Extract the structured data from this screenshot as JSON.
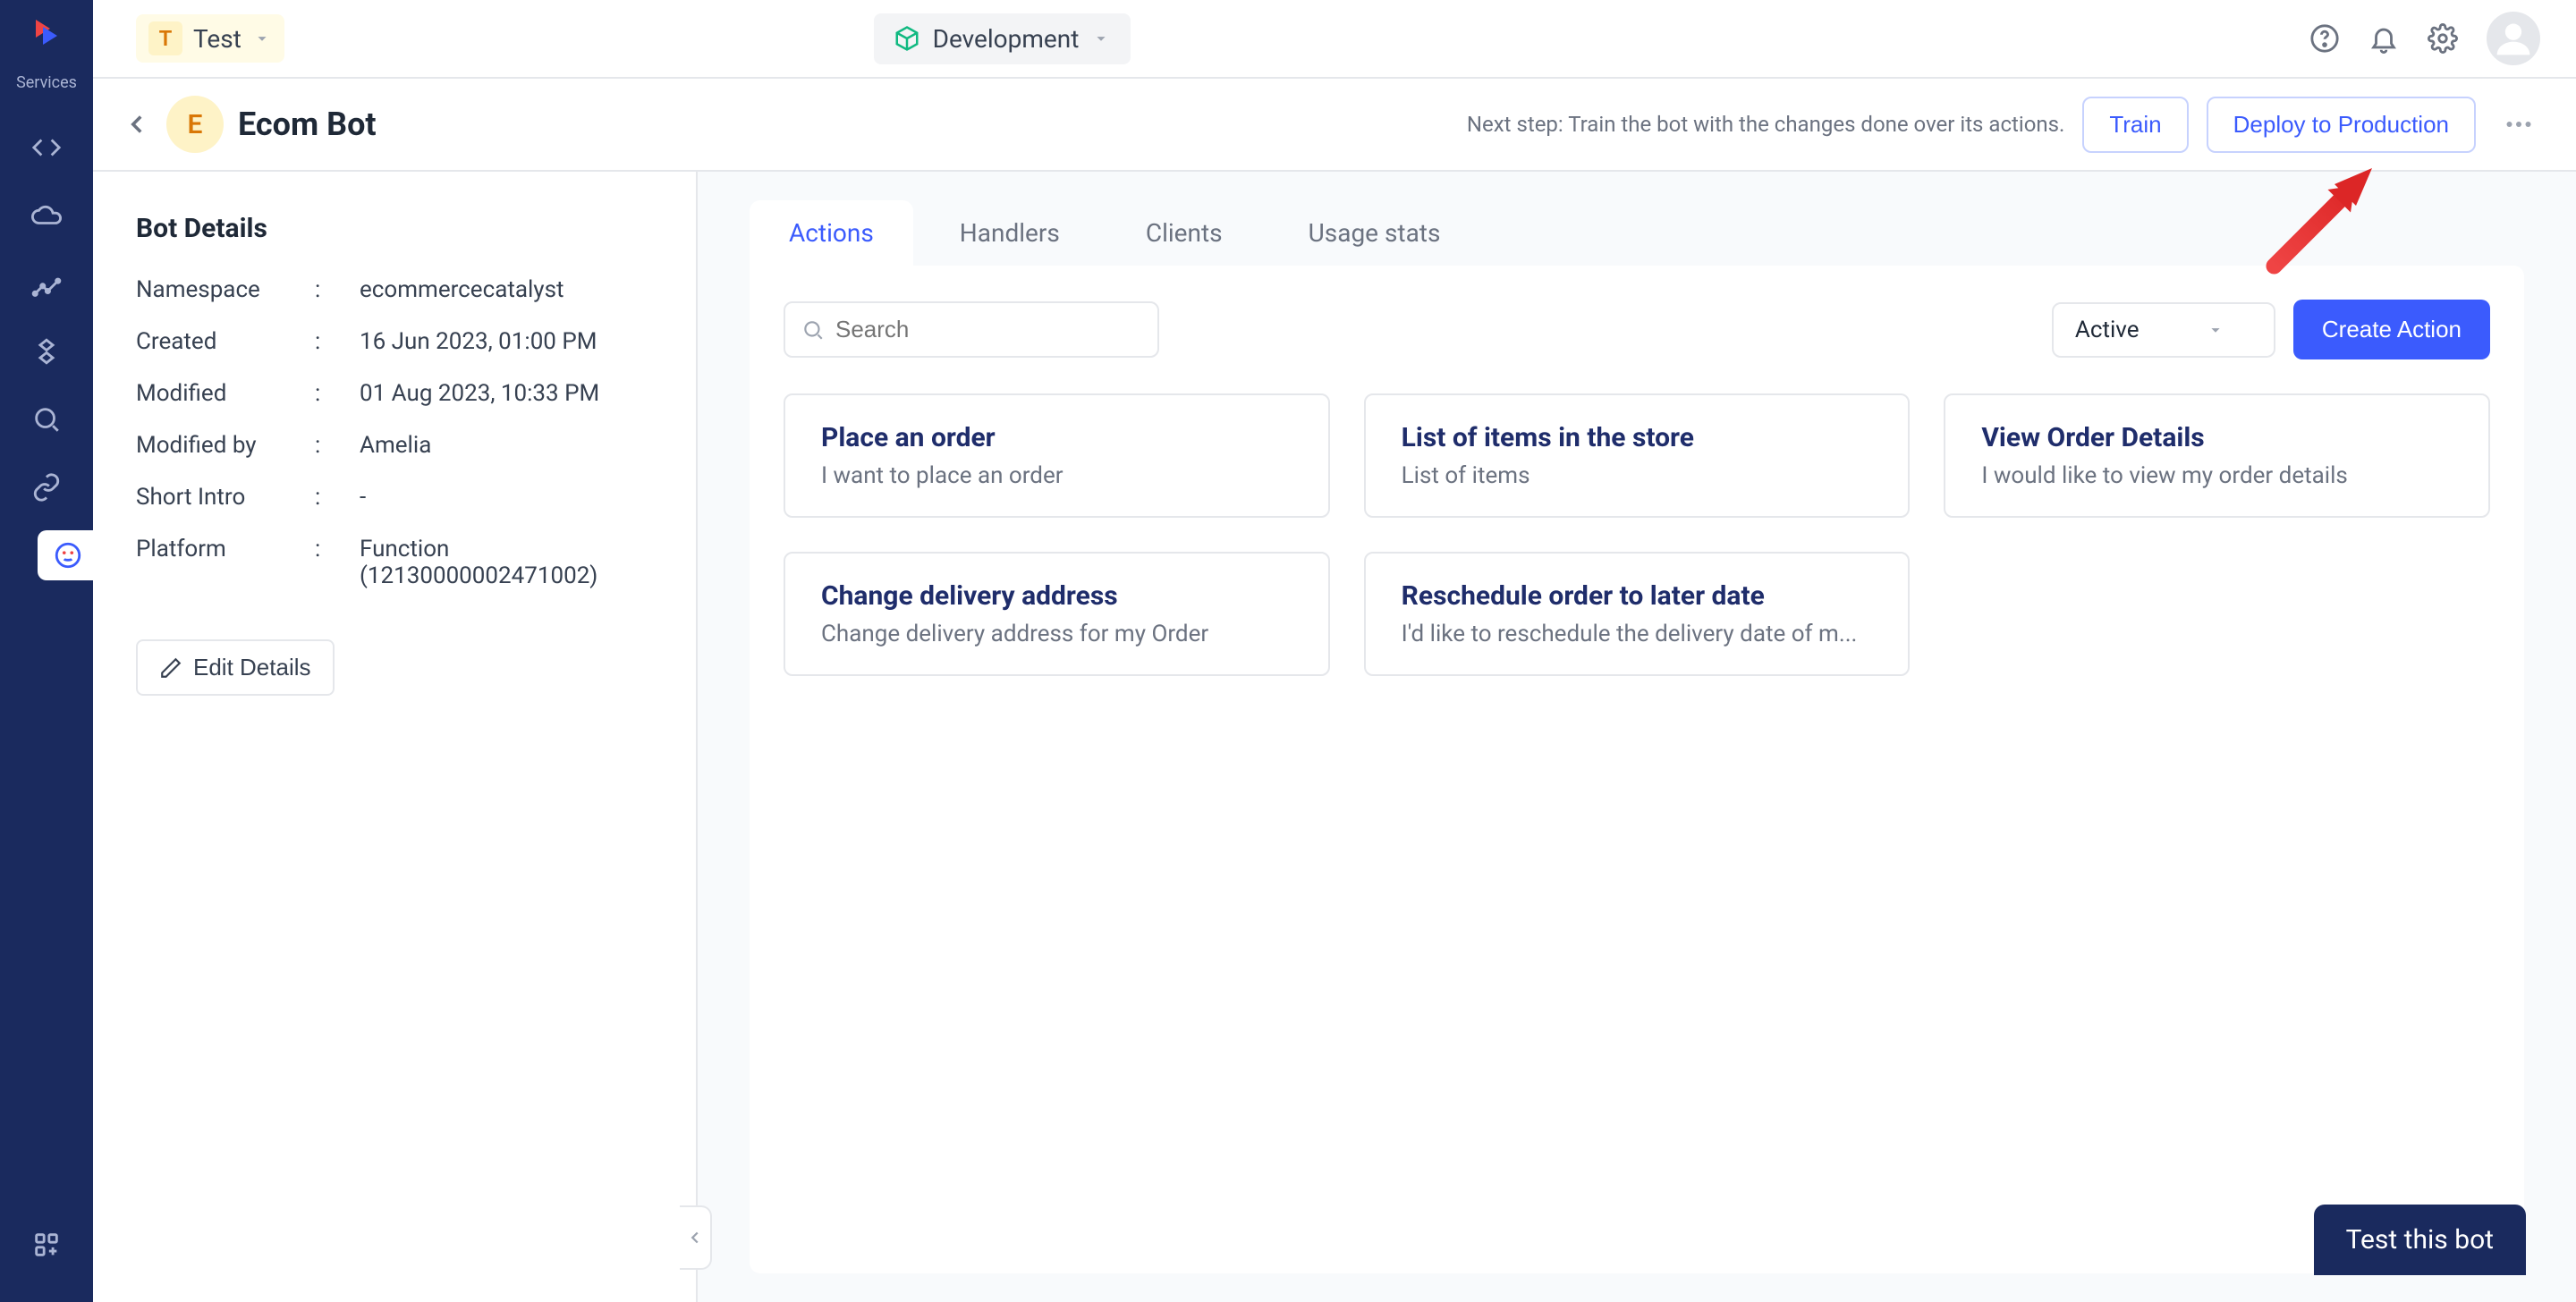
{
  "leftbar": {
    "services_label": "Services"
  },
  "topbar": {
    "org": {
      "letter": "T",
      "name": "Test"
    },
    "env": {
      "label": "Development"
    }
  },
  "subbar": {
    "bot": {
      "letter": "E",
      "name": "Ecom Bot"
    },
    "next_step": "Next step: Train the bot with the changes done over its actions.",
    "train_label": "Train",
    "deploy_label": "Deploy to Production"
  },
  "sidepanel": {
    "heading": "Bot Details",
    "edit_label": "Edit Details",
    "rows": [
      {
        "label": "Namespace",
        "value": "ecommercecatalyst"
      },
      {
        "label": "Created",
        "value": "16 Jun 2023, 01:00 PM"
      },
      {
        "label": "Modified",
        "value": "01 Aug 2023, 10:33 PM"
      },
      {
        "label": "Modified by",
        "value": "Amelia"
      },
      {
        "label": "Short Intro",
        "value": "-"
      },
      {
        "label": "Platform",
        "value": "Function (12130000002471002)"
      }
    ]
  },
  "tabs": [
    {
      "label": "Actions",
      "active": true
    },
    {
      "label": "Handlers",
      "active": false
    },
    {
      "label": "Clients",
      "active": false
    },
    {
      "label": "Usage stats",
      "active": false
    }
  ],
  "toolbar": {
    "search_placeholder": "Search",
    "filter_selected": "Active",
    "create_label": "Create Action"
  },
  "actions": [
    {
      "title": "Place an order",
      "desc": "I want to place an order"
    },
    {
      "title": "List of items in the store",
      "desc": "List of items"
    },
    {
      "title": "View Order Details",
      "desc": "I would like to view my order details"
    },
    {
      "title": "Change delivery address",
      "desc": "Change delivery address for my Order"
    },
    {
      "title": "Reschedule order to later date",
      "desc": "I'd like to reschedule the delivery date of m..."
    }
  ],
  "test_button": "Test this bot"
}
